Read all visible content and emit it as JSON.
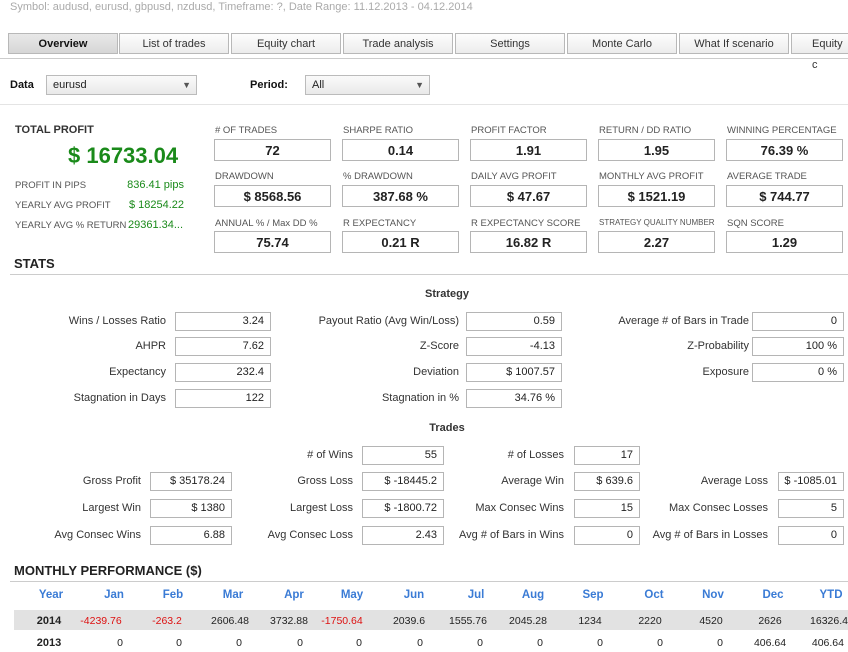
{
  "window": {
    "title": "Symbol: audusd, eurusd, gbpusd, nzdusd, Timeframe: ?, Date Range: 11.12.2013 - 04.12.2014"
  },
  "tabs": [
    {
      "label": "Overview",
      "active": true
    },
    {
      "label": "List of trades",
      "active": false
    },
    {
      "label": "Equity chart",
      "active": false
    },
    {
      "label": "Trade analysis",
      "active": false
    },
    {
      "label": "Settings",
      "active": false
    },
    {
      "label": "Monte Carlo",
      "active": false
    },
    {
      "label": "What If scenario",
      "active": false
    },
    {
      "label": "Equity c",
      "active": false
    }
  ],
  "filters": {
    "data_label": "Data",
    "data_value": "eurusd",
    "period_label": "Period:",
    "period_value": "All"
  },
  "total_profit": {
    "label": "TOTAL PROFIT",
    "value": "$ 16733.04",
    "items": [
      {
        "label": "PROFIT IN PIPS",
        "value": "836.41 pips"
      },
      {
        "label": "YEARLY AVG PROFIT",
        "value": "$ 18254.22"
      },
      {
        "label": "YEARLY AVG % RETURN",
        "value": "29361.34..."
      }
    ]
  },
  "metrics": [
    {
      "label": "# OF TRADES",
      "value": "72"
    },
    {
      "label": "SHARPE RATIO",
      "value": "0.14"
    },
    {
      "label": "PROFIT FACTOR",
      "value": "1.91"
    },
    {
      "label": "RETURN / DD RATIO",
      "value": "1.95"
    },
    {
      "label": "WINNING PERCENTAGE",
      "value": "76.39 %"
    },
    {
      "label": "DRAWDOWN",
      "value": "$ 8568.56"
    },
    {
      "label": "% DRAWDOWN",
      "value": "387.68 %"
    },
    {
      "label": "DAILY AVG PROFIT",
      "value": "$ 47.67"
    },
    {
      "label": "MONTHLY AVG PROFIT",
      "value": "$ 1521.19"
    },
    {
      "label": "AVERAGE TRADE",
      "value": "$ 744.77"
    },
    {
      "label": "ANNUAL % / Max DD %",
      "value": "75.74"
    },
    {
      "label": "R EXPECTANCY",
      "value": "0.21 R"
    },
    {
      "label": "R EXPECTANCY SCORE",
      "value": "16.82 R"
    },
    {
      "label": "STRATEGY QUALITY NUMBER",
      "value": "2.27"
    },
    {
      "label": "SQN SCORE",
      "value": "1.29"
    }
  ],
  "stats": {
    "title": "STATS",
    "strategy_title": "Strategy",
    "strategy": [
      {
        "label": "Wins / Losses Ratio",
        "value": "3.24"
      },
      {
        "label": "Payout Ratio (Avg Win/Loss)",
        "value": "0.59"
      },
      {
        "label": "Average # of Bars in Trade",
        "value": "0"
      },
      {
        "label": "AHPR",
        "value": "7.62"
      },
      {
        "label": "Z-Score",
        "value": "-4.13"
      },
      {
        "label": "Z-Probability",
        "value": "100 %"
      },
      {
        "label": "Expectancy",
        "value": "232.4"
      },
      {
        "label": "Deviation",
        "value": "$ 1007.57"
      },
      {
        "label": "Exposure",
        "value": "0 %"
      },
      {
        "label": "Stagnation in Days",
        "value": "122"
      },
      {
        "label": "Stagnation in %",
        "value": "34.76 %"
      }
    ],
    "trades_title": "Trades",
    "trades_top": [
      {
        "label": "# of Wins",
        "value": "55"
      },
      {
        "label": "# of Losses",
        "value": "17"
      }
    ],
    "trades": [
      {
        "label": "Gross Profit",
        "value": "$ 35178.24"
      },
      {
        "label": "Gross Loss",
        "value": "$ -18445.2"
      },
      {
        "label": "Average Win",
        "value": "$ 639.6"
      },
      {
        "label": "Average Loss",
        "value": "$ -1085.01"
      },
      {
        "label": "Largest Win",
        "value": "$ 1380"
      },
      {
        "label": "Largest Loss",
        "value": "$ -1800.72"
      },
      {
        "label": "Max Consec Wins",
        "value": "15"
      },
      {
        "label": "Max Consec Losses",
        "value": "5"
      },
      {
        "label": "Avg Consec Wins",
        "value": "6.88"
      },
      {
        "label": "Avg Consec Loss",
        "value": "2.43"
      },
      {
        "label": "Avg # of Bars in Wins",
        "value": "0"
      },
      {
        "label": "Avg # of Bars in Losses",
        "value": "0"
      }
    ]
  },
  "monthly": {
    "title": "MONTHLY PERFORMANCE ($)",
    "headers": [
      "Year",
      "Jan",
      "Feb",
      "Mar",
      "Apr",
      "May",
      "Jun",
      "Jul",
      "Aug",
      "Sep",
      "Oct",
      "Nov",
      "Dec",
      "YTD"
    ],
    "rows": [
      {
        "cells": [
          "2014",
          "-4239.76",
          "-263.2",
          "2606.48",
          "3732.88",
          "-1750.64",
          "2039.6",
          "1555.76",
          "2045.28",
          "1234",
          "2220",
          "4520",
          "2626",
          "16326.4"
        ]
      },
      {
        "cells": [
          "2013",
          "0",
          "0",
          "0",
          "0",
          "0",
          "0",
          "0",
          "0",
          "0",
          "0",
          "0",
          "406.64",
          "406.64"
        ]
      }
    ],
    "colors": {
      "header": "#3a7bd5",
      "negative": "#dd1111",
      "row_highlight": "#e2e2e2"
    }
  }
}
